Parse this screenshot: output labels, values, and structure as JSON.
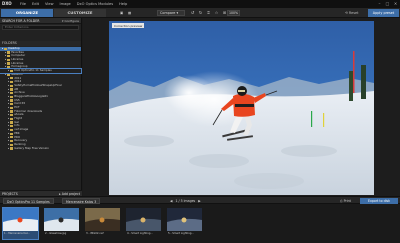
{
  "titlebar": {
    "logo": "DXO",
    "menu": [
      "File",
      "Edit",
      "View",
      "Image",
      "DxO Optics Modules",
      "Help"
    ],
    "window_controls": [
      "minimize-icon",
      "maximize-icon",
      "close-icon"
    ]
  },
  "toolbar": {
    "tab_organize": "ORGANIZE",
    "tab_customize": "CUSTOMIZE",
    "compare_select": "Compare",
    "zoom_value": "100%",
    "reset_label": "Reset",
    "apply_label": "Apply preset"
  },
  "left_panel": {
    "header_title": "SEARCH FOR A FOLDER",
    "header_button": "▾ Configure",
    "search_placeholder": "Enter Criterions",
    "folders_title": "FOLDERS",
    "tree": [
      {
        "label": "Desktop",
        "indent": 0,
        "selected": true
      },
      {
        "label": "Favorites",
        "indent": 1
      },
      {
        "label": "Computer",
        "indent": 1
      },
      {
        "label": "Libraries",
        "indent": 1
      },
      {
        "label": "Libraries",
        "indent": 1
      },
      {
        "label": "Homegroup",
        "indent": 1
      },
      {
        "label": "DxO OpticsPro 11 Samples",
        "indent": 2,
        "highlight": true
      },
      {
        "label": "Network",
        "indent": 1
      },
      {
        "label": "2011",
        "indent": 2
      },
      {
        "label": "2012",
        "indent": 2
      },
      {
        "label": "SafetyHomePhotos2ShapeUpFinal",
        "indent": 2
      },
      {
        "label": "AB",
        "indent": 2
      },
      {
        "label": "Archive",
        "indent": 2
      },
      {
        "label": "BloggersPhotoGoogle61",
        "indent": 2
      },
      {
        "label": "CS5",
        "indent": 2
      },
      {
        "label": "Card P2",
        "indent": 2
      },
      {
        "label": "ECT",
        "indent": 2
      },
      {
        "label": "Fotomac downloads",
        "indent": 2
      },
      {
        "label": "eScala",
        "indent": 2
      },
      {
        "label": "Flight",
        "indent": 2
      },
      {
        "label": "Gel",
        "indent": 2
      },
      {
        "label": "Info",
        "indent": 2
      },
      {
        "label": "nef image",
        "indent": 2
      },
      {
        "label": "PBK",
        "indent": 2
      },
      {
        "label": "PRO",
        "indent": 2
      },
      {
        "label": "Recovery",
        "indent": 2
      },
      {
        "label": "Redoing",
        "indent": 2
      },
      {
        "label": "Gallery Map Free Version",
        "indent": 2
      }
    ],
    "projects_label": "PROJECTS",
    "projects_button": "▸ Add project"
  },
  "viewer": {
    "compare_label": "Correction preview"
  },
  "infobar": {
    "breadcrumb_1": "DxO OpticsPro 11 Samples",
    "breadcrumb_2": "Mercenaire Kalos 3",
    "image_count": "1 / 5 images",
    "print_label": "Print",
    "export_label": "Export to disk"
  },
  "filmstrip": {
    "thumbnails": [
      {
        "caption": "1 - Mercenaire Kal...",
        "active": true
      },
      {
        "caption": "2 - Glasshow.jpg"
      },
      {
        "caption": "3 - IMG02.nef"
      },
      {
        "caption": "4 - Smart Lighting..."
      },
      {
        "caption": "5 - Smart Lighting..."
      }
    ]
  },
  "colors": {
    "accent": "#3d6ea8",
    "panel": "#222222",
    "background": "#1b1b1b",
    "skier_jacket": "#e8451f"
  }
}
